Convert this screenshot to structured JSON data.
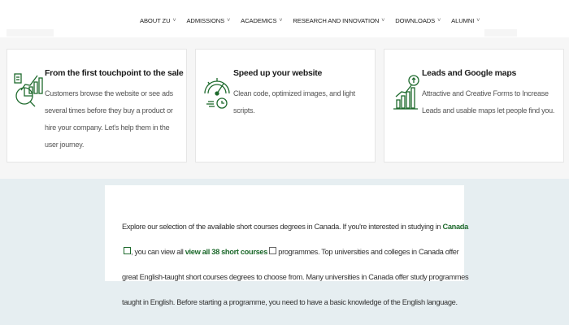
{
  "nav": {
    "items": [
      {
        "label": "ABOUT ZU"
      },
      {
        "label": "ADMISSIONS"
      },
      {
        "label": "ACADEMICS"
      },
      {
        "label": "RESEARCH AND INNOVATION"
      },
      {
        "label": "DOWNLOADS"
      },
      {
        "label": "ALUMNI"
      }
    ],
    "chevron": "˅"
  },
  "cards": [
    {
      "icon": "customer-journey-icon",
      "title": "From the first touchpoint to the sale",
      "text": "Customers browse the website or see ads several times before they buy a product or hire your company. Let's help them in the user journey."
    },
    {
      "icon": "speedometer-icon",
      "title": "Speed up your website",
      "text": "Clean code, optimized images, and light scripts."
    },
    {
      "icon": "growth-chart-icon",
      "title": "Leads and Google maps",
      "text": "Attractive and Creative Forms to Increase Leads and usable maps let people find you."
    }
  ],
  "intro": {
    "part1": "Explore our selection of the available short courses degrees in Canada. If you're interested in studying in ",
    "link1": "Canada",
    "part2": ", you can view all ",
    "link2": "view all 38 short courses",
    "part3": " programmes. Top universities and colleges in Canada offer great English-taught short courses degrees to choose from. Many universities in Canada offer study programmes taught in English. Before starting a programme, you need to have a basic knowledge of the English language."
  },
  "colors": {
    "accent_green": "#1e6a2d",
    "lower_band": "#e6eef1"
  }
}
